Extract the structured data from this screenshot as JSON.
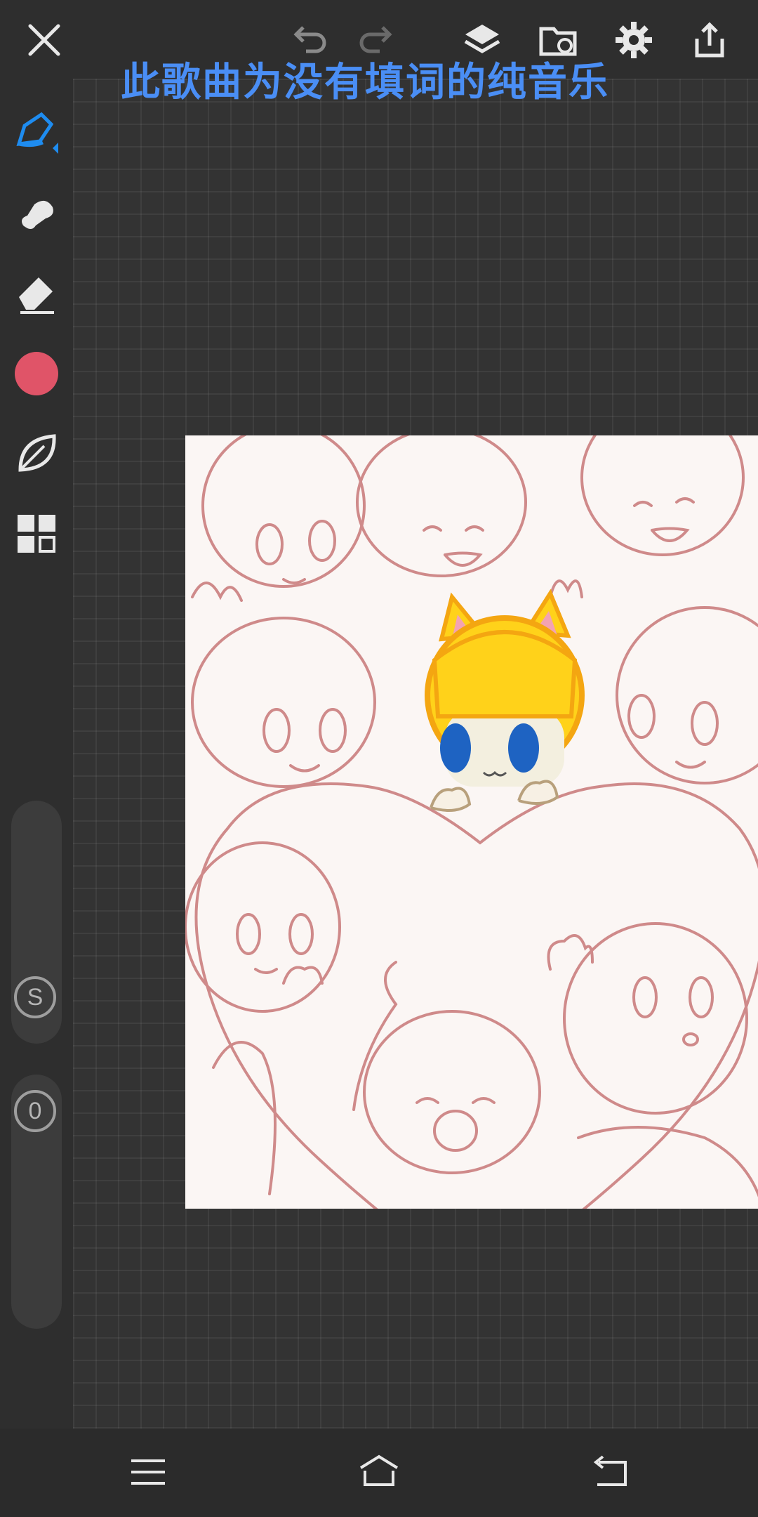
{
  "lyric_overlay": "此歌曲为没有填词的纯音乐",
  "toolbar": {
    "close_icon": "close-icon",
    "undo_icon": "undo-icon",
    "redo_icon": "redo-icon",
    "layers_icon": "layers-icon",
    "file_icon": "folder-sync-icon",
    "settings_icon": "gear-icon",
    "share_icon": "share-icon"
  },
  "tools": [
    {
      "name": "pen",
      "icon": "pen-icon",
      "active": true,
      "color": "#1e8cf0"
    },
    {
      "name": "smudge",
      "icon": "smudge-icon",
      "active": false
    },
    {
      "name": "eraser",
      "icon": "eraser-icon",
      "active": false
    },
    {
      "name": "color",
      "icon": "color-swatch",
      "active": false,
      "color": "#e05468"
    },
    {
      "name": "brush-style",
      "icon": "leaf-icon",
      "active": false
    },
    {
      "name": "menu",
      "icon": "grid-icon",
      "active": false
    }
  ],
  "sliders": {
    "size_label": "S",
    "opacity_label": "0"
  },
  "navbar": {
    "menu_icon": "hamburger-icon",
    "home_icon": "home-icon",
    "back_icon": "back-icon"
  },
  "colors": {
    "accent": "#1e8cf0",
    "lyric": "#4a8ef5",
    "current_color": "#e05468"
  }
}
